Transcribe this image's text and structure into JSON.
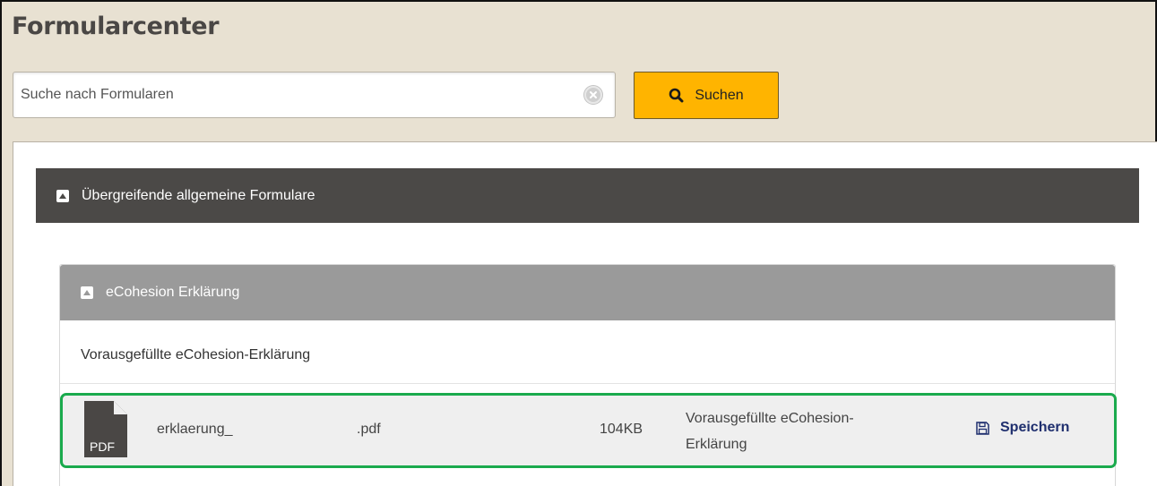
{
  "page": {
    "title": "Formularcenter"
  },
  "search": {
    "placeholder": "Suche nach Formularen",
    "value": "",
    "button_label": "Suchen"
  },
  "category": {
    "label": "Übergreifende allgemeine Formulare",
    "expanded": true
  },
  "subcategory": {
    "label": "eCohesion Erklärung",
    "expanded": true,
    "description": "Vorausgefüllte eCohesion-Erklärung"
  },
  "files": [
    {
      "type_badge": "PDF",
      "name": "erklaerung_",
      "extension": ".pdf",
      "size": "104KB",
      "description": "Vorausgefüllte eCohesion-Erklärung",
      "action_label": "Speichern"
    }
  ],
  "colors": {
    "header_bg": "#e8e1d2",
    "accent": "#ffb400",
    "category_bg": "#4b4947",
    "subcategory_bg": "#9a9a9a",
    "highlight": "#1aaa4d",
    "link": "#1f2f6e"
  },
  "icons": {
    "search": "search-icon",
    "clear": "clear-search-icon",
    "collapse": "collapse-icon",
    "file": "pdf-file-icon",
    "save": "floppy-disk-icon"
  }
}
